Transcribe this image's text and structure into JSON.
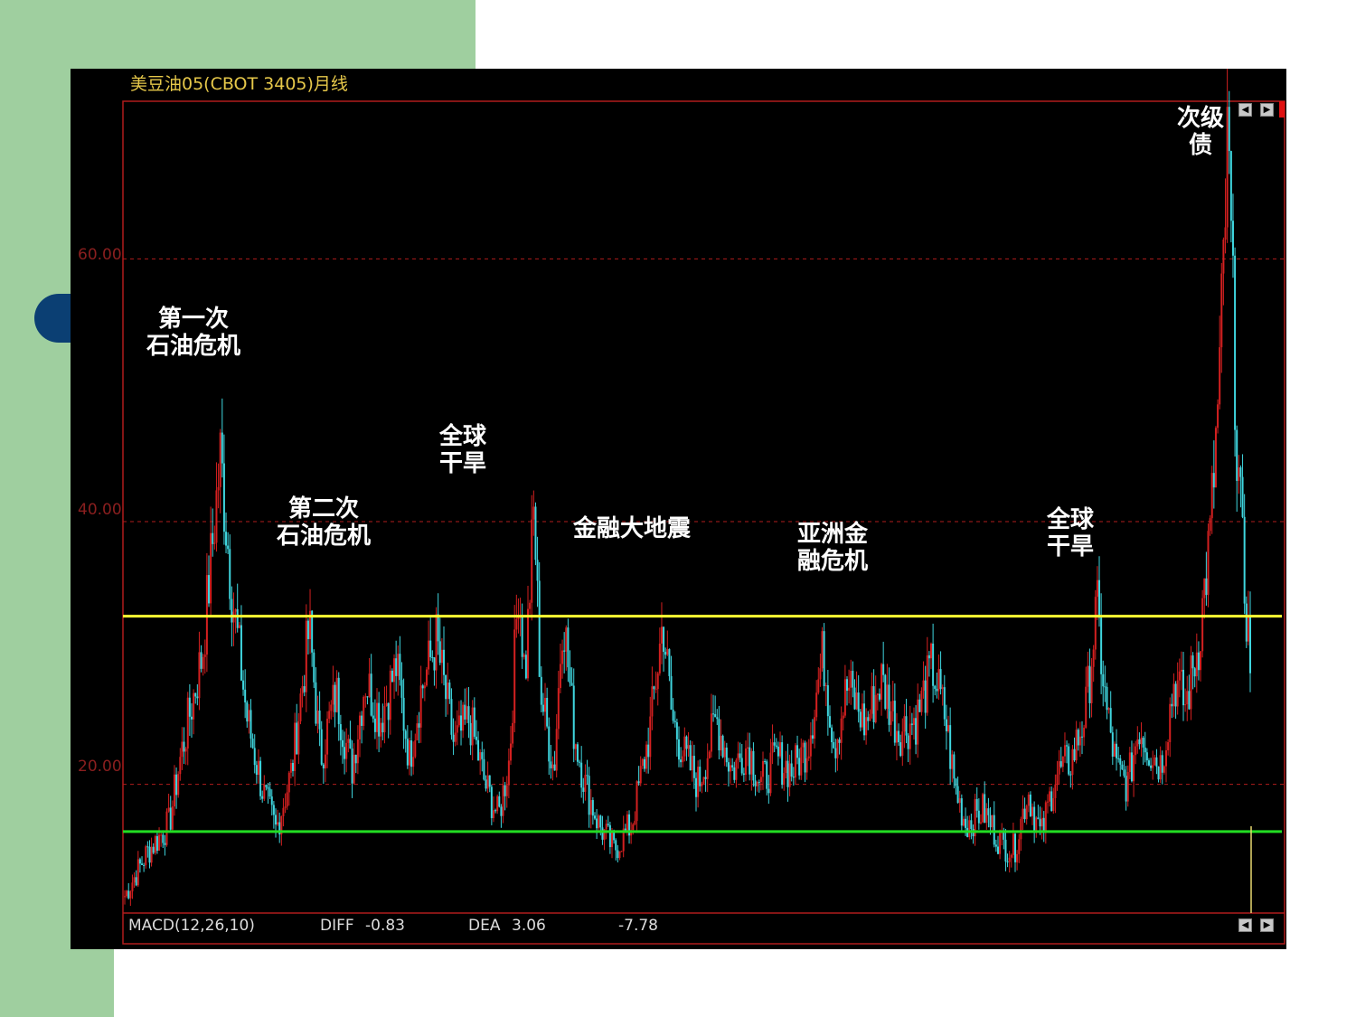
{
  "title": "美豆油05(CBOT 3405)月线",
  "chart_data": {
    "type": "candlestick",
    "title": "美豆油05(CBOT 3405)月线",
    "yticks": [
      "60.00",
      "40.00",
      "20.00"
    ],
    "ytick_values": [
      60,
      40,
      20
    ],
    "ylim": [
      10.2,
      72
    ],
    "grid": true,
    "colors": {
      "up": "#d42020",
      "down": "#3fd6df",
      "resistance": "#ffff33",
      "support": "#22dd22",
      "grid": "#b01c1c"
    },
    "reference_lines": [
      {
        "color": "yellow",
        "value": 32.8
      },
      {
        "color": "green",
        "value": 16.4
      }
    ],
    "annotations": [
      {
        "text": "第一次\n石油危机",
        "x": 1974.0,
        "y": 54
      },
      {
        "text": "第二次\n石油危机",
        "x": 1979.5,
        "y": 40
      },
      {
        "text": "全球\n干旱",
        "x": 1987.5,
        "y": 48.5
      },
      {
        "text": "金融大地震",
        "x": 1995.0,
        "y": 38.5
      },
      {
        "text": "亚洲金\n融危机",
        "x": 2003.5,
        "y": 37.5
      },
      {
        "text": "全球\n干旱",
        "x": 2014.0,
        "y": 38.5
      },
      {
        "text": "次级\n债",
        "x": 2019.5,
        "y": 69
      }
    ],
    "monthly_close": [
      [
        1970.0,
        11.5
      ],
      [
        1971.0,
        14.8
      ],
      [
        1972.0,
        17.0
      ],
      [
        1972.5,
        22.0
      ],
      [
        1973.5,
        30.0
      ],
      [
        1974.3,
        45.0
      ],
      [
        1974.8,
        35.0
      ],
      [
        1975.5,
        25.0
      ],
      [
        1976.2,
        19.5
      ],
      [
        1976.8,
        16.5
      ],
      [
        1977.5,
        21.0
      ],
      [
        1978.3,
        32.0
      ],
      [
        1978.8,
        22.0
      ],
      [
        1979.5,
        27.0
      ],
      [
        1980.2,
        21.0
      ],
      [
        1980.8,
        28.0
      ],
      [
        1981.5,
        25.0
      ],
      [
        1982.2,
        29.0
      ],
      [
        1982.8,
        22.0
      ],
      [
        1983.3,
        27.0
      ],
      [
        1984.0,
        31.0
      ],
      [
        1984.8,
        23.0
      ],
      [
        1985.5,
        25.0
      ],
      [
        1986.2,
        20.0
      ],
      [
        1986.8,
        17.5
      ],
      [
        1987.3,
        22.0
      ],
      [
        1987.7,
        35.5
      ],
      [
        1988.0,
        28.0
      ],
      [
        1988.4,
        41.0
      ],
      [
        1988.7,
        27.0
      ],
      [
        1989.3,
        21.0
      ],
      [
        1989.7,
        33.5
      ],
      [
        1990.2,
        24.0
      ],
      [
        1990.7,
        20.0
      ],
      [
        1991.3,
        17.0
      ],
      [
        1992.0,
        15.0
      ],
      [
        1992.8,
        17.0
      ],
      [
        1993.6,
        24.0
      ],
      [
        1994.2,
        32.5
      ],
      [
        1994.6,
        25.0
      ],
      [
        1995.2,
        22.0
      ],
      [
        1995.8,
        20.0
      ],
      [
        1996.6,
        25.0
      ],
      [
        1997.3,
        21.0
      ],
      [
        1998.0,
        23.0
      ],
      [
        1998.6,
        20.0
      ],
      [
        1999.3,
        22.0
      ],
      [
        2000.0,
        21.0
      ],
      [
        2000.7,
        23.0
      ],
      [
        2001.4,
        30.0
      ],
      [
        2001.9,
        23.0
      ],
      [
        2002.5,
        27.5
      ],
      [
        2003.3,
        24.5
      ],
      [
        2004.0,
        28.0
      ],
      [
        2004.8,
        24.0
      ],
      [
        2005.6,
        25.0
      ],
      [
        2006.3,
        29.0
      ],
      [
        2006.9,
        25.0
      ],
      [
        2007.3,
        20.0
      ],
      [
        2007.8,
        17.0
      ],
      [
        2008.6,
        18.0
      ],
      [
        2009.4,
        15.5
      ],
      [
        2010.0,
        15.0
      ],
      [
        2010.6,
        19.5
      ],
      [
        2011.2,
        16.0
      ],
      [
        2011.8,
        20.5
      ],
      [
        2012.6,
        22.0
      ],
      [
        2013.2,
        25.5
      ],
      [
        2013.7,
        33.5
      ],
      [
        2014.1,
        26.0
      ],
      [
        2014.6,
        21.0
      ],
      [
        2015.1,
        20.0
      ],
      [
        2015.6,
        24.5
      ],
      [
        2016.1,
        22.5
      ],
      [
        2016.6,
        21.5
      ],
      [
        2017.2,
        28.0
      ],
      [
        2017.7,
        26.0
      ],
      [
        2018.3,
        31.0
      ],
      [
        2018.8,
        39.0
      ],
      [
        2019.2,
        50.0
      ],
      [
        2019.6,
        69.0
      ],
      [
        2020.0,
        46.0
      ],
      [
        2020.3,
        36.0
      ],
      [
        2020.6,
        29.5
      ]
    ]
  },
  "macd": {
    "label": "MACD(12,26,10)",
    "diff_label": "DIFF",
    "diff_value": "-0.83",
    "dea_label": "DEA",
    "dea_value": "3.06",
    "macd_value": "-7.78"
  }
}
